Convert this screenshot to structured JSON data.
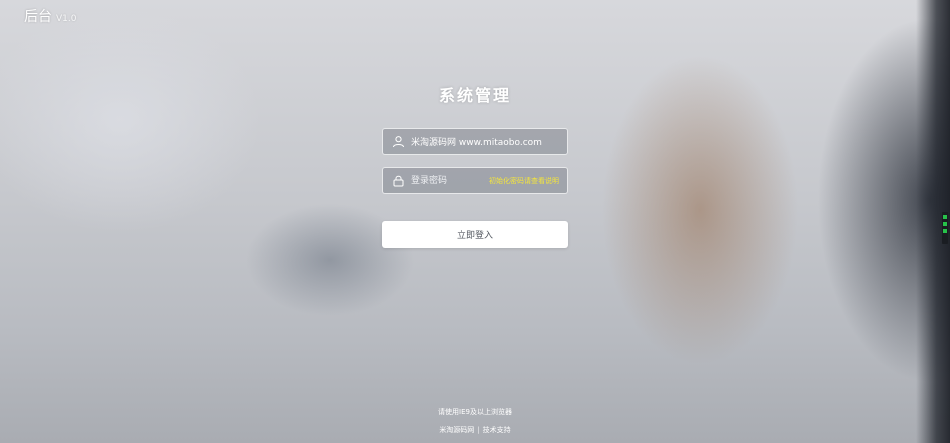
{
  "brand": {
    "name": "后台",
    "version": "V1.0"
  },
  "login": {
    "title": "系统管理",
    "username_value": "米淘源码网 www.mitaobo.com",
    "password_placeholder": "登录密码",
    "password_hint": "初始化密码请查看说明",
    "submit_label": "立即登入",
    "icons": [
      "user-icon",
      "lock-icon"
    ]
  },
  "footer": {
    "line1": "请使用IE9及以上浏览器",
    "link1": "米淘源码网",
    "separator": "|",
    "link2": "技术支持"
  },
  "colors": {
    "hint": "#f5e63a",
    "button_bg": "#ffffff",
    "status_led": "#27c24a"
  }
}
